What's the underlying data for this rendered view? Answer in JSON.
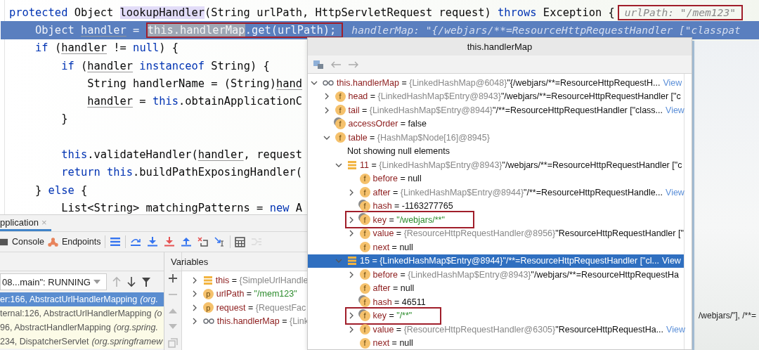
{
  "editor": {
    "lines": [
      {
        "current": false,
        "tokens": [
          {
            "text": "protected",
            "kind": "keyword"
          },
          {
            "text": " Object ",
            "kind": "plain"
          },
          {
            "text": "lookupHandler",
            "kind": "usage"
          },
          {
            "text": "(String urlPath, HttpServletRequest request) ",
            "kind": "plain"
          },
          {
            "text": "throws",
            "kind": "keyword"
          },
          {
            "text": " Exception {",
            "kind": "plain"
          }
        ],
        "hint": {
          "text": "urlPath: \"/mem123\"",
          "boxed": true
        }
      },
      {
        "current": true,
        "tokens": [
          {
            "text": "    Object ",
            "kind": "plain",
            "boxed": false
          },
          {
            "text": "handler",
            "kind": "variable",
            "boxed": false
          },
          {
            "text": " = ",
            "kind": "plain",
            "boxed": false
          },
          {
            "text": "this.handlerMap",
            "kind": "selection",
            "boxed": true
          },
          {
            "text": ".get(urlPath);",
            "kind": "plain",
            "boxed": true
          }
        ],
        "hint": {
          "text": "handlerMap: \"{/webjars/**=ResourceHttpRequestHandler [\"classpat",
          "boxed": false
        }
      },
      {
        "current": false,
        "tokens": [
          {
            "text": "    if",
            "kind": "keyword"
          },
          {
            "text": " (",
            "kind": "plain"
          },
          {
            "text": "handler",
            "kind": "variable"
          },
          {
            "text": " != ",
            "kind": "plain"
          },
          {
            "text": "null",
            "kind": "keyword"
          },
          {
            "text": ") {",
            "kind": "plain"
          }
        ]
      },
      {
        "current": false,
        "tokens": [
          {
            "text": "        if",
            "kind": "keyword"
          },
          {
            "text": " (",
            "kind": "plain"
          },
          {
            "text": "handler",
            "kind": "variable"
          },
          {
            "text": " instanceof",
            "kind": "keyword"
          },
          {
            "text": " String) {",
            "kind": "plain"
          }
        ]
      },
      {
        "current": false,
        "tokens": [
          {
            "text": "            String handlerName = (String)",
            "kind": "plain"
          },
          {
            "text": "hand",
            "kind": "variable"
          }
        ]
      },
      {
        "current": false,
        "tokens": [
          {
            "text": "            handler",
            "kind": "variable"
          },
          {
            "text": " = ",
            "kind": "plain"
          },
          {
            "text": "this",
            "kind": "keyword"
          },
          {
            "text": ".obtainApplicationC",
            "kind": "plain"
          }
        ]
      },
      {
        "current": false,
        "tokens": [
          {
            "text": "        }",
            "kind": "plain"
          }
        ]
      },
      {
        "current": false
      },
      {
        "current": false,
        "tokens": [
          {
            "text": "        this",
            "kind": "keyword"
          },
          {
            "text": ".validateHandler(",
            "kind": "plain"
          },
          {
            "text": "handler",
            "kind": "variable"
          },
          {
            "text": ", request",
            "kind": "plain"
          }
        ]
      },
      {
        "current": false,
        "tokens": [
          {
            "text": "        return",
            "kind": "keyword"
          },
          {
            "text": " this",
            "kind": "keyword"
          },
          {
            "text": ".buildPathExposingHandler(",
            "kind": "plain"
          }
        ]
      },
      {
        "current": false,
        "tokens": [
          {
            "text": "    } ",
            "kind": "plain"
          },
          {
            "text": "else",
            "kind": "keyword"
          },
          {
            "text": " {",
            "kind": "plain"
          }
        ]
      },
      {
        "current": false,
        "tokens": [
          {
            "text": "        List<String> matchingPatterns = ",
            "kind": "plain"
          },
          {
            "text": "new",
            "kind": "keyword"
          },
          {
            "text": " A",
            "kind": "plain"
          }
        ]
      }
    ]
  },
  "debug": {
    "tab": {
      "label": "pplication",
      "close": "×"
    },
    "toolbar": [
      {
        "kind": "console",
        "label": "Console",
        "disabled": false
      },
      {
        "kind": "endpoints",
        "label": "Endpoints",
        "disabled": false
      },
      {
        "kind": "threads",
        "disabled": false
      },
      {
        "kind": "step-over",
        "disabled": false
      },
      {
        "kind": "step-into",
        "disabled": false
      },
      {
        "kind": "force-step-into",
        "disabled": false
      },
      {
        "kind": "step-out",
        "disabled": false
      },
      {
        "kind": "drop-frame",
        "disabled": false
      },
      {
        "kind": "run-to-cursor",
        "disabled": false
      },
      {
        "kind": "evaluate",
        "disabled": false
      },
      {
        "kind": "trace",
        "disabled": true
      }
    ],
    "thread": {
      "value": "08...main\": RUNNING",
      "nav": [
        {
          "kind": "up",
          "disabled": true
        },
        {
          "kind": "down",
          "disabled": false
        },
        {
          "kind": "filter",
          "disabled": false
        }
      ]
    },
    "frames": [
      {
        "method": "er:166, AbstractUrlHandlerMapping",
        "package": "(org.",
        "selected": true
      },
      {
        "method": "ternal:126, AbstractUrlHandlerMapping",
        "package": "(o",
        "selected": false
      },
      {
        "method": "96, AbstractHandlerMapping",
        "package": "(org.spring.",
        "selected": false
      },
      {
        "method": "234, DispatcherServlet",
        "package": "(org.springframew",
        "selected": false
      }
    ],
    "side_tools": [
      {
        "kind": "add",
        "disabled": false
      },
      {
        "kind": "remove",
        "disabled": true
      },
      {
        "kind": "up",
        "disabled": true
      },
      {
        "kind": "down",
        "disabled": true
      },
      {
        "kind": "copy",
        "disabled": true
      }
    ],
    "variables": {
      "title": "Variables",
      "items": [
        {
          "kind": "array",
          "name": "this",
          "op": "=",
          "type": "{SimpleUrlHandle",
          "expanded": false,
          "selected": false
        },
        {
          "kind": "param",
          "icon": "p",
          "name": "urlPath",
          "op": "=",
          "value": "\"/mem123\"",
          "literal": true,
          "expanded": false,
          "selected": false
        },
        {
          "kind": "param",
          "icon": "p",
          "name": "request",
          "op": "=",
          "type": "{RequestFac",
          "expanded": false,
          "selected": false
        },
        {
          "kind": "watch",
          "name": "this.handlerMap",
          "op": "=",
          "type": "{Link",
          "expanded": false,
          "selected": false
        }
      ]
    }
  },
  "popup": {
    "title": "this.handlerMap",
    "tree": [
      {
        "kind": "watch",
        "name": "this.handlerMap",
        "op": "=",
        "type": "{LinkedHashMap@6048}",
        "value": "\"{/webjars/**=ResourceHttpRequestH...",
        "literal": false,
        "link": "View",
        "expanded": true,
        "selected": false,
        "outlined": false,
        "children": [
          {
            "kind": "field",
            "icon": "f",
            "name": "head",
            "op": "=",
            "type": "{LinkedHashMap$Entry@8943}",
            "value": "\"/webjars/**=ResourceHttpRequestHandler [\"c",
            "literal": false,
            "expanded": false,
            "selected": false,
            "outlined": false
          },
          {
            "kind": "field",
            "icon": "f",
            "name": "tail",
            "op": "=",
            "type": "{LinkedHashMap$Entry@8944}",
            "value": "\"/**=ResourceHttpRequestHandler [\"class...",
            "literal": false,
            "link": "View",
            "expanded": false,
            "selected": false,
            "outlined": false
          },
          {
            "kind": "transient",
            "icon": "f",
            "name": "accessOrder",
            "op": "=",
            "value": "false",
            "literal": false,
            "selected": false,
            "outlined": false
          },
          {
            "kind": "field",
            "icon": "f",
            "name": "table",
            "op": "=",
            "type": "{HashMap$Node[16]@8945}",
            "expanded": true,
            "selected": false,
            "outlined": false,
            "children": [
              {
                "kind": "note",
                "name": "Not showing null elements",
                "selected": false,
                "outlined": false
              },
              {
                "kind": "array",
                "name": "11",
                "op": "=",
                "type": "{LinkedHashMap$Entry@8943}",
                "value": "\"/webjars/**=ResourceHttpRequestHandler [\"c",
                "literal": false,
                "expanded": true,
                "selected": false,
                "outlined": false,
                "children": [
                  {
                    "kind": "field",
                    "icon": "f",
                    "name": "before",
                    "op": "=",
                    "value": "null",
                    "literal": false,
                    "selected": false,
                    "outlined": false
                  },
                  {
                    "kind": "field",
                    "icon": "f",
                    "name": "after",
                    "op": "=",
                    "type": "{LinkedHashMap$Entry@8944}",
                    "value": "\"/**=ResourceHttpRequestHandle...",
                    "literal": false,
                    "link": "View",
                    "expanded": false,
                    "selected": false,
                    "outlined": false
                  },
                  {
                    "kind": "transient",
                    "icon": "f",
                    "name": "hash",
                    "op": "=",
                    "value": "-1163277765",
                    "literal": false,
                    "selected": false,
                    "outlined": false
                  },
                  {
                    "kind": "transient",
                    "icon": "f",
                    "name": "key",
                    "op": "=",
                    "value": "\"/webjars/**\"",
                    "literal": true,
                    "expanded": false,
                    "selected": false,
                    "outlined": true
                  },
                  {
                    "kind": "field",
                    "icon": "f",
                    "name": "value",
                    "op": "=",
                    "type": "{ResourceHttpRequestHandler@8956}",
                    "value": "\"ResourceHttpRequestHandler [\"",
                    "literal": false,
                    "expanded": false,
                    "selected": false,
                    "outlined": false
                  },
                  {
                    "kind": "field",
                    "icon": "f",
                    "name": "next",
                    "op": "=",
                    "value": "null",
                    "literal": false,
                    "selected": false,
                    "outlined": false
                  }
                ]
              },
              {
                "kind": "array",
                "name": "15",
                "op": "=",
                "type": "{LinkedHashMap$Entry@8944}",
                "value": "\"/**=ResourceHttpRequestHandler [\"cl...",
                "literal": false,
                "link": "View",
                "expanded": true,
                "selected": true,
                "outlined": false,
                "children": [
                  {
                    "kind": "field",
                    "icon": "f",
                    "name": "before",
                    "op": "=",
                    "type": "{LinkedHashMap$Entry@8943}",
                    "value": "\"/webjars/**=ResourceHttpRequestHa",
                    "literal": false,
                    "expanded": false,
                    "selected": false,
                    "outlined": false
                  },
                  {
                    "kind": "field",
                    "icon": "f",
                    "name": "after",
                    "op": "=",
                    "value": "null",
                    "literal": false,
                    "selected": false,
                    "outlined": false
                  },
                  {
                    "kind": "transient",
                    "icon": "f",
                    "name": "hash",
                    "op": "=",
                    "value": "46511",
                    "literal": false,
                    "selected": false,
                    "outlined": false
                  },
                  {
                    "kind": "transient",
                    "icon": "f",
                    "name": "key",
                    "op": "=",
                    "value": "\"/**\"",
                    "literal": true,
                    "expanded": false,
                    "selected": false,
                    "outlined": true
                  },
                  {
                    "kind": "field",
                    "icon": "f",
                    "name": "value",
                    "op": "=",
                    "type": "{ResourceHttpRequestHandler@6305}",
                    "value": "\"ResourceHttpRequestHa...",
                    "literal": false,
                    "link": "View",
                    "expanded": false,
                    "selected": false,
                    "outlined": false
                  },
                  {
                    "kind": "field",
                    "icon": "f",
                    "name": "next",
                    "op": "=",
                    "value": "null",
                    "literal": false,
                    "selected": false,
                    "outlined": false
                  }
                ]
              }
            ]
          }
        ]
      }
    ]
  },
  "background_text": "/webjars/\"], /**="
}
